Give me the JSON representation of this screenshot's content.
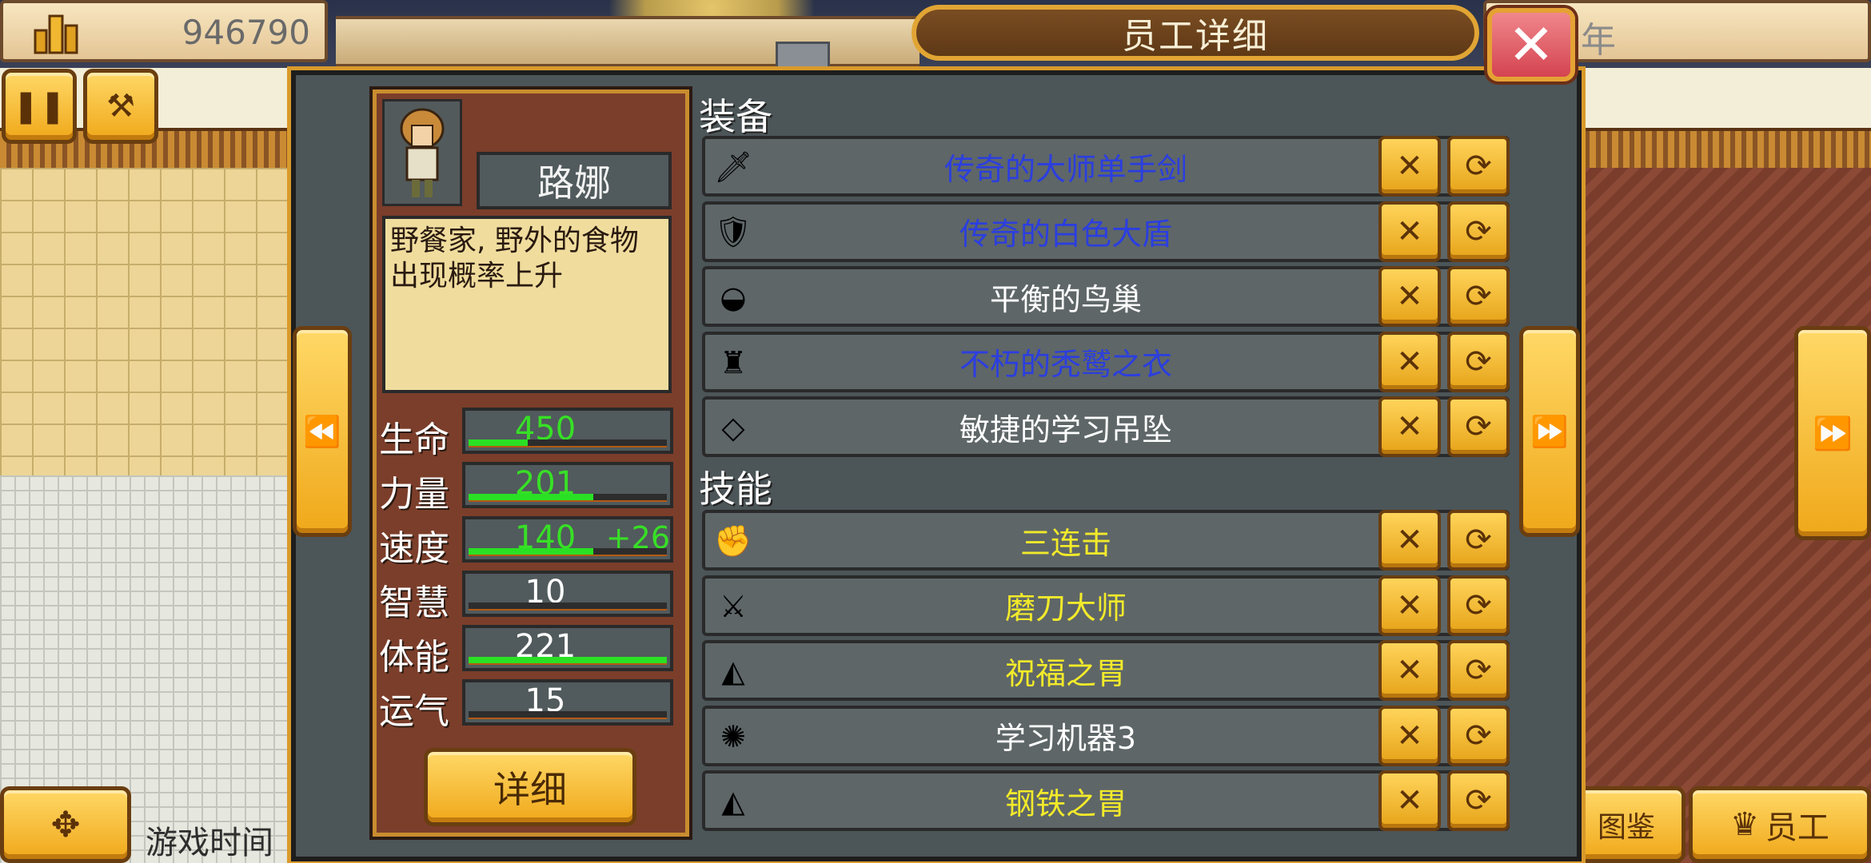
{
  "hud": {
    "money": "946790",
    "right_bar_text": "年",
    "pause_icon": "pause-icon",
    "tools_icon": "tools-icon",
    "move_icon": "move-arrows-icon",
    "game_time_label": "游戏时间",
    "gallery_label": "图鉴",
    "staff_label": "员工"
  },
  "dialog": {
    "title": "员工详细",
    "close_glyph": "✕",
    "prev_glyph": "⏪",
    "next_glyph": "⏩"
  },
  "character": {
    "name": "路娜",
    "description": "野餐家, 野外的食物出现概率上升",
    "detail_label": "详细",
    "stats": [
      {
        "label": "生命",
        "value": "450",
        "bonus": "",
        "color": "#37e026",
        "fill": 0.3
      },
      {
        "label": "力量",
        "value": "201",
        "bonus": "",
        "color": "#37e026",
        "fill": 0.63
      },
      {
        "label": "速度",
        "value": "140",
        "bonus": "+26",
        "color": "#37e026",
        "fill": 0.63
      },
      {
        "label": "智慧",
        "value": "10",
        "bonus": "",
        "color": "#ffffff",
        "fill": 0.0
      },
      {
        "label": "体能",
        "value": "221",
        "bonus": "",
        "color": "#ffffff",
        "fill": 1.0
      },
      {
        "label": "运气",
        "value": "15",
        "bonus": "",
        "color": "#ffffff",
        "fill": 0.0
      }
    ]
  },
  "equipment": {
    "title": "装备",
    "items": [
      {
        "name": "传奇的大师单手剑",
        "color": "#2b3ee0",
        "icon": "sword-icon",
        "glyph": "🗡"
      },
      {
        "name": "传奇的白色大盾",
        "color": "#2b3ee0",
        "icon": "shield-icon",
        "glyph": "🛡"
      },
      {
        "name": "平衡的鸟巢",
        "color": "#ffffff",
        "icon": "nest-icon",
        "glyph": "◒"
      },
      {
        "name": "不朽的秃鹫之衣",
        "color": "#2b3ee0",
        "icon": "armor-icon",
        "glyph": "♜"
      },
      {
        "name": "敏捷的学习吊坠",
        "color": "#ffffff",
        "icon": "pendant-icon",
        "glyph": "◇"
      }
    ]
  },
  "skills": {
    "title": "技能",
    "items": [
      {
        "name": "三连击",
        "color": "#f2ea2a",
        "icon": "triple-strike-icon",
        "glyph": "✊"
      },
      {
        "name": "磨刀大师",
        "color": "#f2ea2a",
        "icon": "sharpen-icon",
        "glyph": "⚔"
      },
      {
        "name": "祝福之胃",
        "color": "#f2ea2a",
        "icon": "cake-icon",
        "glyph": "◭"
      },
      {
        "name": "学习机器3",
        "color": "#ffffff",
        "icon": "spark-icon",
        "glyph": "✺"
      },
      {
        "name": "钢铁之胃",
        "color": "#f2ea2a",
        "icon": "cake-icon",
        "glyph": "◭"
      }
    ]
  },
  "buttons": {
    "remove_glyph": "✕",
    "swap_glyph": "⟳"
  }
}
